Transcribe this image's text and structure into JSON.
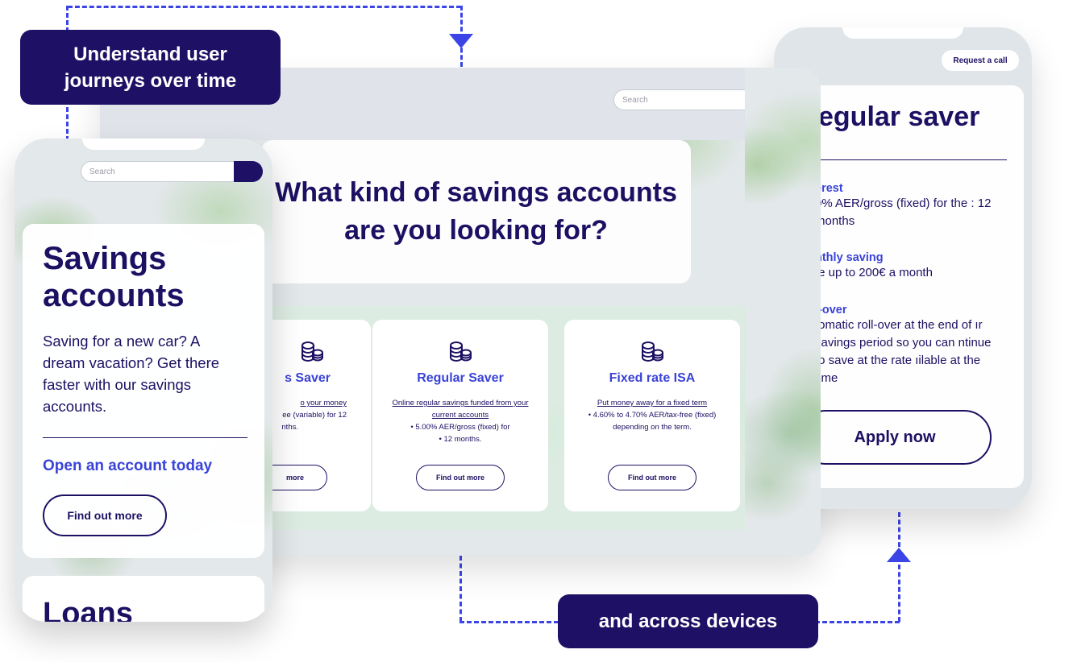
{
  "callouts": {
    "top": "Understand user journeys over time",
    "bottom": "and across devices"
  },
  "desktop": {
    "search_placeholder": "Search",
    "hero_title": "What kind of savings accounts are you looking for?",
    "cards": [
      {
        "icon": "coins-icon",
        "title": "Easy Access Saver",
        "visible_title": "s Saver",
        "desc_lines": [
          "o your money",
          "ee (variable) for 12",
          "nths."
        ],
        "cta": "Find out more",
        "visible_cta": "more"
      },
      {
        "icon": "coins-icon",
        "title": "Regular Saver",
        "desc_link": "Online regular savings funded from your current accounts",
        "bullets": [
          "5.00% AER/gross (fixed) for",
          "12 months."
        ],
        "cta": "Find out more"
      },
      {
        "icon": "coins-icon",
        "title": "Fixed rate ISA",
        "desc_link": "Put money away for a fixed term",
        "bullets": [
          "4.60% to 4.70% AER/tax-free (fixed) depending on the term."
        ],
        "cta": "Find out more"
      }
    ]
  },
  "mobile_left": {
    "search_placeholder": "Search",
    "title": "Savings accounts",
    "body": "Saving for a new car? A dream vacation? Get there faster with our savings accounts.",
    "link": "Open an account today",
    "cta": "Find out more",
    "next_title": "Loans"
  },
  "mobile_right": {
    "request_call": "Request a call",
    "title": "egular saver",
    "sections": [
      {
        "title": "erest",
        "body": "0% AER/gross (fixed) for the : 12 months"
      },
      {
        "title": "nthly saving",
        "body": "/e up to 200€ a month"
      },
      {
        "title": "l-over",
        "body": ":omatic roll-over at the end of ır savings period so you can ntinue to save at the rate ıilable at the time"
      }
    ],
    "cta": "Apply now"
  },
  "colors": {
    "navy": "#1e1165",
    "accent_blue": "#3a43d8",
    "dash_blue": "#3b45e6"
  }
}
